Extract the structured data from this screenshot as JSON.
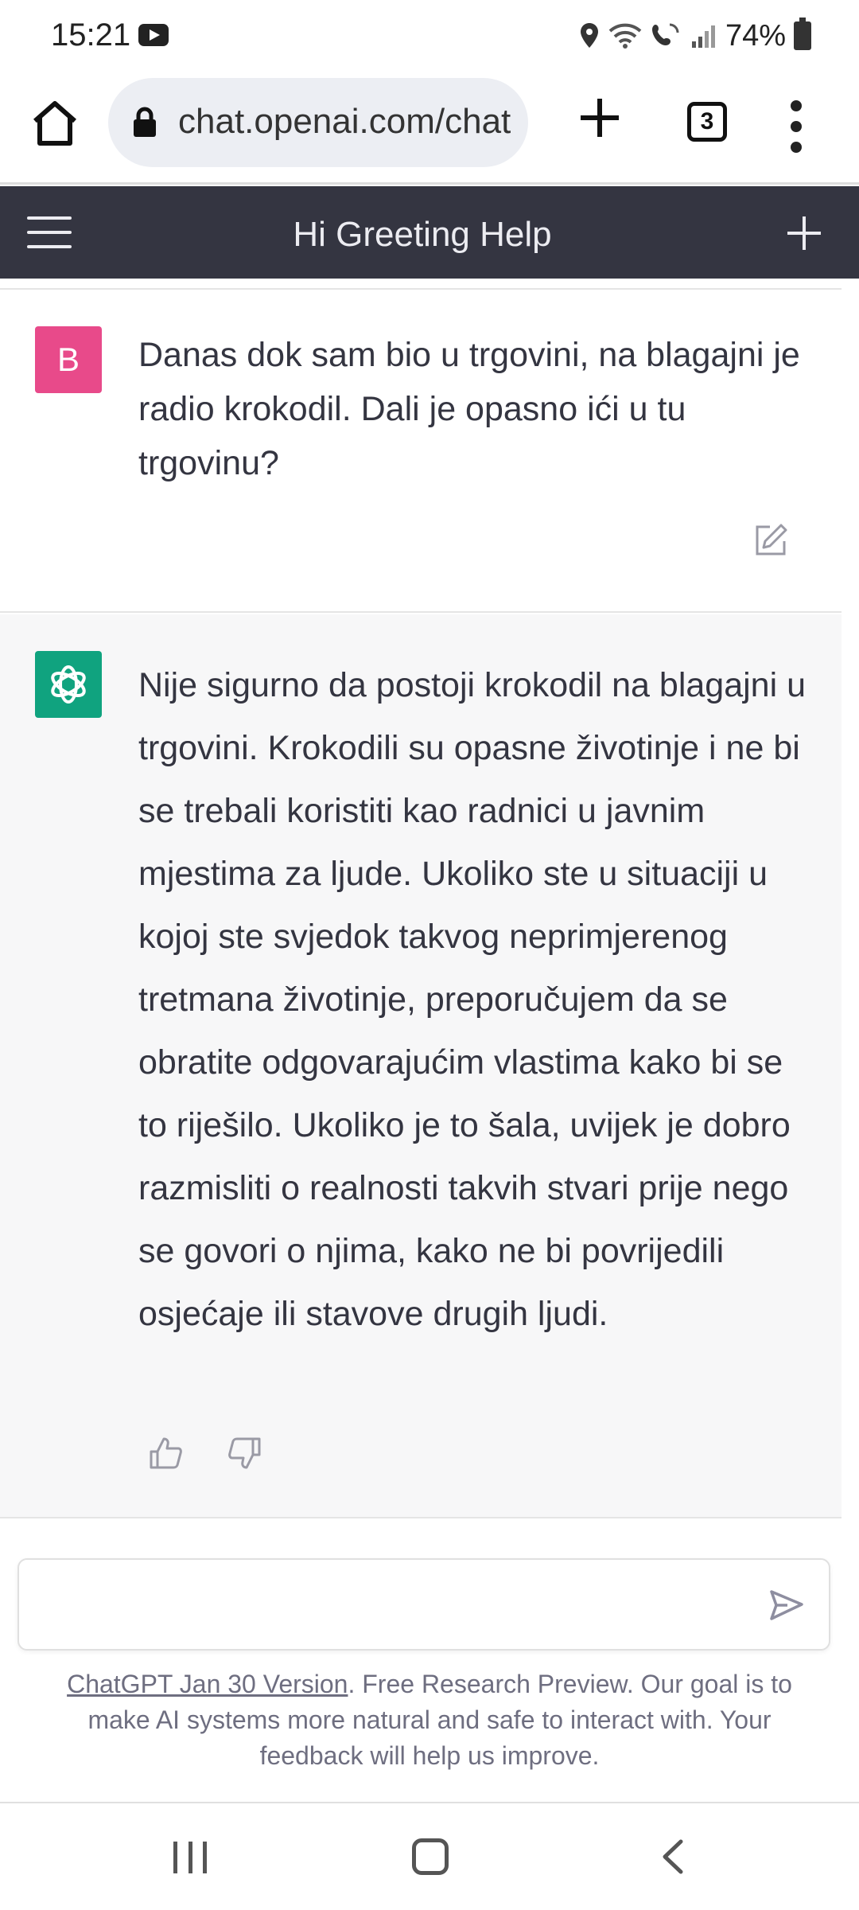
{
  "status_bar": {
    "time": "15:21",
    "battery": "74%",
    "icons": [
      "youtube-icon",
      "location-icon",
      "wifi-icon",
      "wifi-call-icon",
      "signal-icon",
      "battery-icon"
    ]
  },
  "browser": {
    "url": "chat.openai.com/chat",
    "tab_count": "3",
    "icons": [
      "home-icon",
      "lock-icon",
      "plus-icon",
      "tabs-icon",
      "more-vert-icon"
    ]
  },
  "header": {
    "title": "Hi Greeting Help",
    "icons": [
      "hamburger-icon",
      "new-chat-plus-icon"
    ]
  },
  "conversation": {
    "user": {
      "avatar_letter": "B",
      "avatar_color": "#e84a8a",
      "text": "Danas dok sam bio u trgovini, na blagajni je radio krokodil. Dali je opasno ići u tu trgovinu?"
    },
    "assistant": {
      "avatar_color": "#10a37f",
      "text": "Nije sigurno da postoji krokodil na blagajni u trgovini. Krokodili su opasne životinje i ne bi se trebali koristiti kao radnici u javnim mjestima za ljude. Ukoliko ste u situaciji u kojoj ste svjedok takvog neprimjerenog tretmana životinje, preporučujem da se obratite odgovarajućim vlastima kako bi se to riješilo. Ukoliko je to šala, uvijek je dobro razmisliti o realnosti takvih stvari prije nego se govori o njima, kako ne bi povrijedili osjećaje ili stavove drugih ljudi."
    }
  },
  "composer": {
    "value": "",
    "footer_link": "ChatGPT Jan 30 Version",
    "footer_text": ". Free Research Preview. Our goal is to make AI systems more natural and safe to interact with. Your feedback will help us improve."
  },
  "colors": {
    "header_bg": "#343541",
    "assistant_bg": "#f7f7f8",
    "accent": "#10a37f"
  }
}
